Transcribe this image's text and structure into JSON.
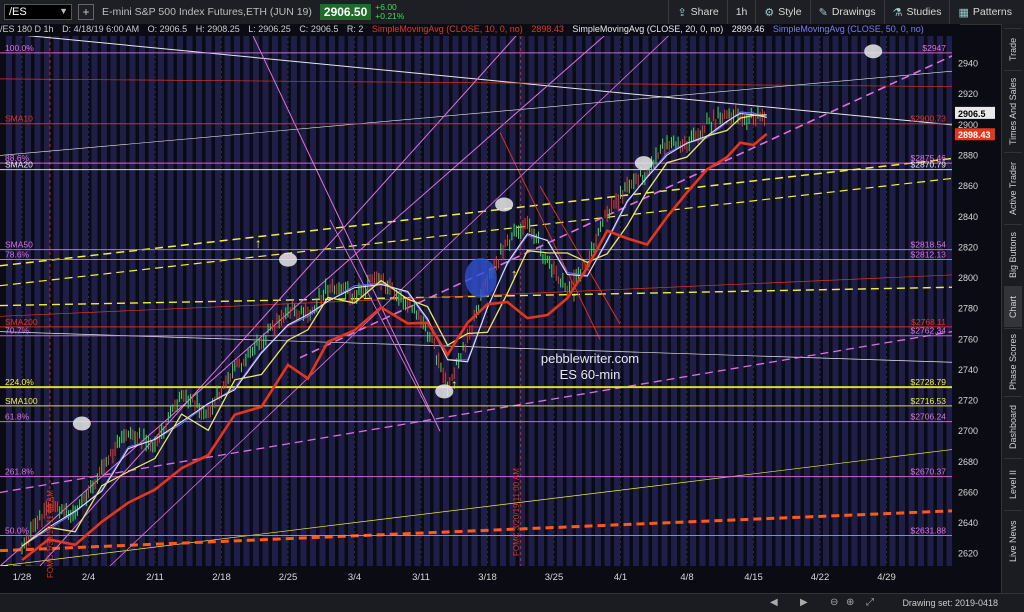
{
  "header": {
    "symbol": "/ES",
    "description": "E-mini S&P 500 Index Futures,ETH (JUN 19)",
    "last_price": "2906.50",
    "change_abs": "+6.00",
    "change_pct": "+0.21%",
    "tools": [
      {
        "icon": "share-icon",
        "label": "Share"
      },
      {
        "icon": "timeframe-icon",
        "label": "1h"
      },
      {
        "icon": "style-icon",
        "label": "Style"
      },
      {
        "icon": "drawings-icon",
        "label": "Drawings"
      },
      {
        "icon": "studies-icon",
        "label": "Studies"
      },
      {
        "icon": "patterns-icon",
        "label": "Patterns"
      }
    ]
  },
  "infobar": {
    "symbol_period": "/ES 180 D 1h",
    "d": "D: 4/18/19 6:00 AM",
    "o": "O: 2906.5",
    "h": "H: 2908.25",
    "l": "L: 2906.25",
    "c": "C: 2906.5",
    "r": "R: 2",
    "sma10": "SimpleMovingAvg (CLOSE, 10, 0, no)",
    "sma10_val": "2898.43",
    "sma20": "SimpleMovingAvg (CLOSE, 20, 0, no)",
    "sma20_val": "2899.46",
    "sma50": "SimpleMovingAvg (CLOSE, 50, 0, no)"
  },
  "sidebar": [
    "Trade",
    "Times And Sales",
    "Active Trader",
    "Big Buttons",
    "Chart",
    "Phase Scores",
    "Dashboard",
    "Level II",
    "Live News"
  ],
  "statusbar": {
    "drawing_set": "Drawing set: 2019-0418"
  },
  "annotations": {
    "watermark1": "pebblewriter.com",
    "watermark2": "ES 60-min",
    "vline1": "FOMC 3/20/19 11:00 AM",
    "vline2": "FOMC 1/30/19 11:00 AM"
  },
  "chart_data": {
    "type": "line",
    "title": "/ES 180 D 1h",
    "x_ticks": [
      "1/28",
      "2/4",
      "2/11",
      "2/18",
      "2/25",
      "3/4",
      "3/11",
      "3/18",
      "3/25",
      "4/1",
      "4/8",
      "4/15",
      "4/22",
      "4/29"
    ],
    "y_ticks": [
      2620,
      2640,
      2660,
      2680,
      2700,
      2720,
      2740,
      2760,
      2780,
      2800,
      2820,
      2840,
      2860,
      2880,
      2900,
      2920,
      2940
    ],
    "ylim": [
      2612,
      2958
    ],
    "price_path": [
      [
        0,
        2625
      ],
      [
        0.4,
        2652
      ],
      [
        0.8,
        2645
      ],
      [
        1.2,
        2675
      ],
      [
        1.6,
        2700
      ],
      [
        2.0,
        2690
      ],
      [
        2.4,
        2725
      ],
      [
        2.8,
        2712
      ],
      [
        3.2,
        2740
      ],
      [
        3.6,
        2760
      ],
      [
        4.0,
        2780
      ],
      [
        4.3,
        2775
      ],
      [
        4.6,
        2795
      ],
      [
        5.0,
        2790
      ],
      [
        5.4,
        2800
      ],
      [
        5.8,
        2784
      ],
      [
        6.1,
        2765
      ],
      [
        6.4,
        2728
      ],
      [
        6.7,
        2760
      ],
      [
        7.0,
        2800
      ],
      [
        7.3,
        2822
      ],
      [
        7.6,
        2838
      ],
      [
        7.9,
        2810
      ],
      [
        8.2,
        2792
      ],
      [
        8.5,
        2810
      ],
      [
        8.8,
        2842
      ],
      [
        9.1,
        2860
      ],
      [
        9.4,
        2870
      ],
      [
        9.7,
        2888
      ],
      [
        10.0,
        2888
      ],
      [
        10.3,
        2900
      ],
      [
        10.6,
        2906
      ],
      [
        10.8,
        2907
      ],
      [
        11.0,
        2904
      ],
      [
        11.2,
        2906.5
      ]
    ],
    "series": [
      {
        "name": "SimpleMovingAvg (CLOSE, 10, 0, no)",
        "color": "#e9e66a"
      },
      {
        "name": "SimpleMovingAvg (CLOSE, 20, 0, no)",
        "color": "#e9e9e9"
      },
      {
        "name": "SimpleMovingAvg (CLOSE, 50, 0, no)",
        "color": "#6a6aff"
      },
      {
        "name": "SMA200",
        "color": "#e2361e"
      }
    ],
    "levels": [
      {
        "label": "100.0%",
        "value": 2947,
        "price_label": "$2947",
        "color": "#e070e0"
      },
      {
        "label": "SMA10",
        "value": 2900.73,
        "price_label": "$2900.73",
        "color": "#e2361e"
      },
      {
        "label": "88.6%",
        "value": 2875,
        "price_label": "$2875.46",
        "color": "#e070e0"
      },
      {
        "label": "SMA20",
        "value": 2870.79,
        "price_label": "$2870.79",
        "color": "#e9e9e9"
      },
      {
        "label": "SMA50",
        "value": 2818.54,
        "price_label": "$2818.54",
        "color": "#e070e0"
      },
      {
        "label": "78.6%",
        "value": 2812.13,
        "price_label": "$2812.13",
        "color": "#e070e0"
      },
      {
        "label": "SMA200",
        "value": 2768.11,
        "price_label": "$2768.11",
        "color": "#e2361e"
      },
      {
        "label": "70.7%",
        "value": 2762.34,
        "price_label": "$2762.34",
        "color": "#e070e0"
      },
      {
        "label": "224.0%",
        "value": 2728.79,
        "price_label": "$2728.79",
        "color": "#f0f03a"
      },
      {
        "label": "SMA100",
        "value": 2716.53,
        "price_label": "$2716.53",
        "color": "#f0f03a"
      },
      {
        "label": "61.8%",
        "value": 2706.24,
        "price_label": "$2706.24",
        "color": "#e070e0"
      },
      {
        "label": "261.8%",
        "value": 2670.37,
        "price_label": "$2670.37",
        "color": "#e070e0"
      },
      {
        "label": "50.0%",
        "value": 2631.88,
        "price_label": "$2631.88",
        "color": "#e070e0"
      }
    ],
    "current_price_tags": [
      {
        "value": 2906.5,
        "label": "2906.5",
        "color": "#e9e9e9"
      },
      {
        "value": 2898.43,
        "label": "2898.43",
        "color": "#e2361e"
      }
    ]
  }
}
